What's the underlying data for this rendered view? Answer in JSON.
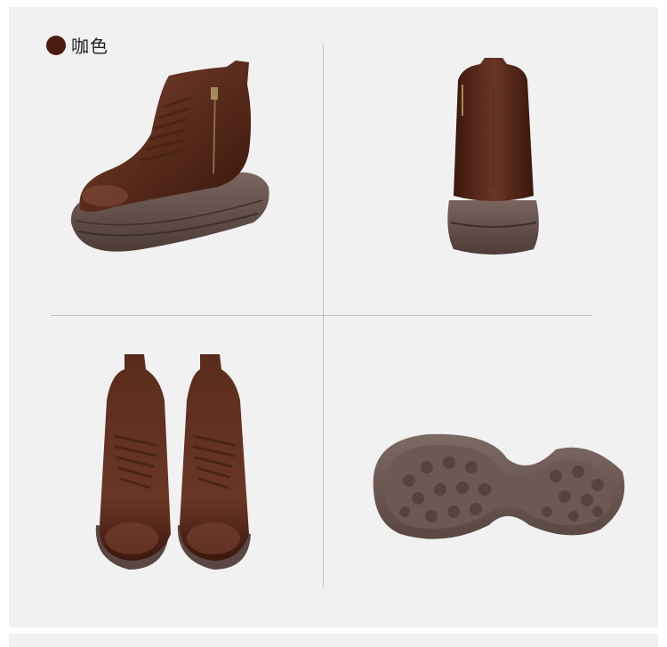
{
  "color_option": {
    "swatch_color": "#4b1d12",
    "label": "咖色"
  },
  "views": [
    {
      "name": "side-view",
      "icon": "boot-side-view"
    },
    {
      "name": "back-view",
      "icon": "boot-back-view"
    },
    {
      "name": "front-pair-view",
      "icon": "boot-pair-front-view"
    },
    {
      "name": "sole-view",
      "icon": "boot-sole-view"
    }
  ],
  "colors": {
    "leather": "#5a2c1c",
    "leather_dark": "#3a170d",
    "sole": "#6a5550",
    "background": "#f1f1f1"
  }
}
